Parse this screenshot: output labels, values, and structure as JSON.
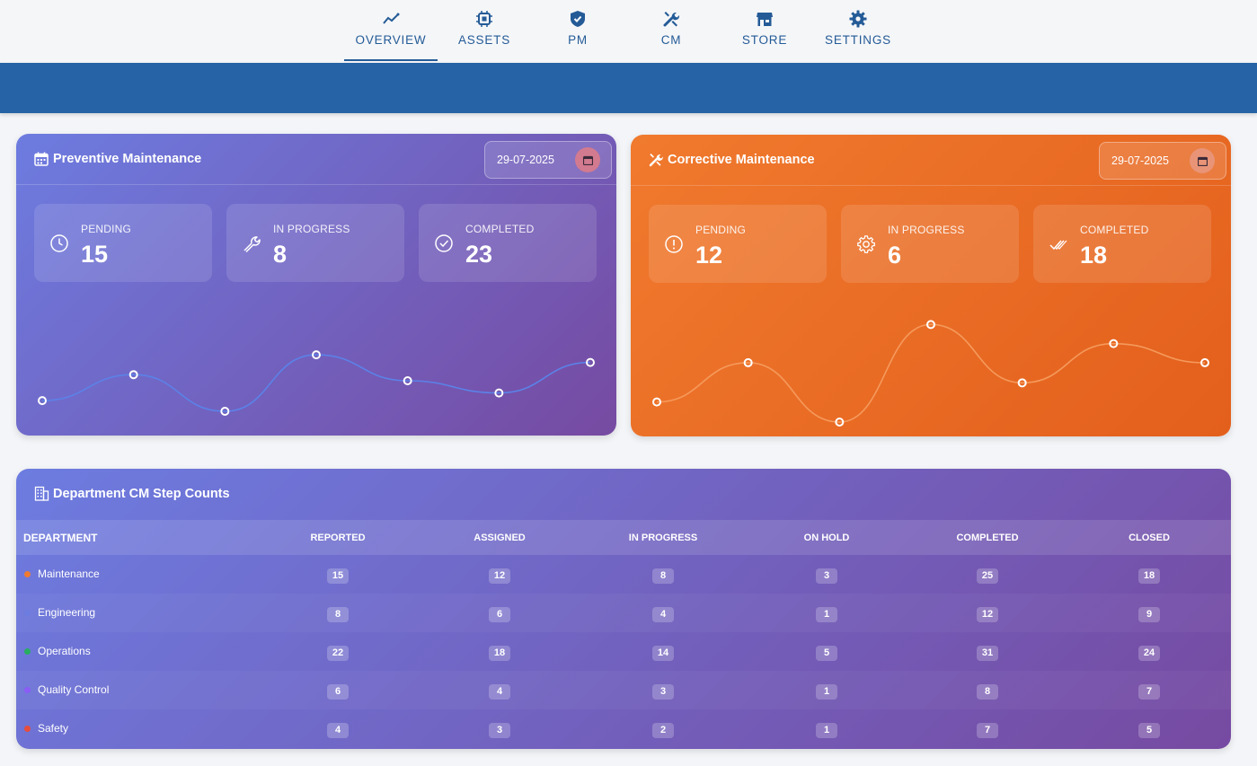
{
  "nav": {
    "items": [
      {
        "label": "OVERVIEW",
        "icon": "chart-line-icon",
        "active": true
      },
      {
        "label": "ASSETS",
        "icon": "chip-icon",
        "active": false
      },
      {
        "label": "PM",
        "icon": "shield-check-icon",
        "active": false
      },
      {
        "label": "CM",
        "icon": "tools-icon",
        "active": false
      },
      {
        "label": "STORE",
        "icon": "store-icon",
        "active": false
      },
      {
        "label": "SETTINGS",
        "icon": "gear-icon",
        "active": false
      }
    ]
  },
  "pm": {
    "title": "Preventive Maintenance",
    "date": "29-07-2025",
    "stats": [
      {
        "label": "PENDING",
        "value": "15",
        "icon": "clock-icon"
      },
      {
        "label": "IN PROGRESS",
        "value": "8",
        "icon": "wrench-icon"
      },
      {
        "label": "COMPLETED",
        "value": "23",
        "icon": "check-circle-icon"
      }
    ],
    "trend": [
      0.14,
      0.48,
      0.0,
      0.74,
      0.4,
      0.24,
      0.64
    ]
  },
  "cm": {
    "title": "Corrective Maintenance",
    "date": "29-07-2025",
    "stats": [
      {
        "label": "PENDING",
        "value": "12",
        "icon": "alert-circle-icon"
      },
      {
        "label": "IN PROGRESS",
        "value": "6",
        "icon": "cog-icon"
      },
      {
        "label": "COMPLETED",
        "value": "18",
        "icon": "double-check-icon"
      }
    ],
    "trend": [
      0.2,
      0.59,
      0.0,
      0.97,
      0.39,
      0.78,
      0.59
    ]
  },
  "departments": {
    "title": "Department CM Step Counts",
    "columns": [
      "DEPARTMENT",
      "REPORTED",
      "ASSIGNED",
      "IN PROGRESS",
      "ON HOLD",
      "COMPLETED",
      "CLOSED"
    ],
    "rows": [
      {
        "name": "Maintenance",
        "color": "#f07a2e",
        "values": [
          "15",
          "12",
          "8",
          "3",
          "25",
          "18"
        ]
      },
      {
        "name": "Engineering",
        "color": "#6d7ce0",
        "values": [
          "8",
          "6",
          "4",
          "1",
          "12",
          "9"
        ]
      },
      {
        "name": "Operations",
        "color": "#27ae60",
        "values": [
          "22",
          "18",
          "14",
          "5",
          "31",
          "24"
        ]
      },
      {
        "name": "Quality Control",
        "color": "#8b5cf6",
        "values": [
          "6",
          "4",
          "3",
          "1",
          "8",
          "7"
        ]
      },
      {
        "name": "Safety",
        "color": "#e74c3c",
        "values": [
          "4",
          "3",
          "2",
          "1",
          "7",
          "5"
        ]
      }
    ]
  }
}
